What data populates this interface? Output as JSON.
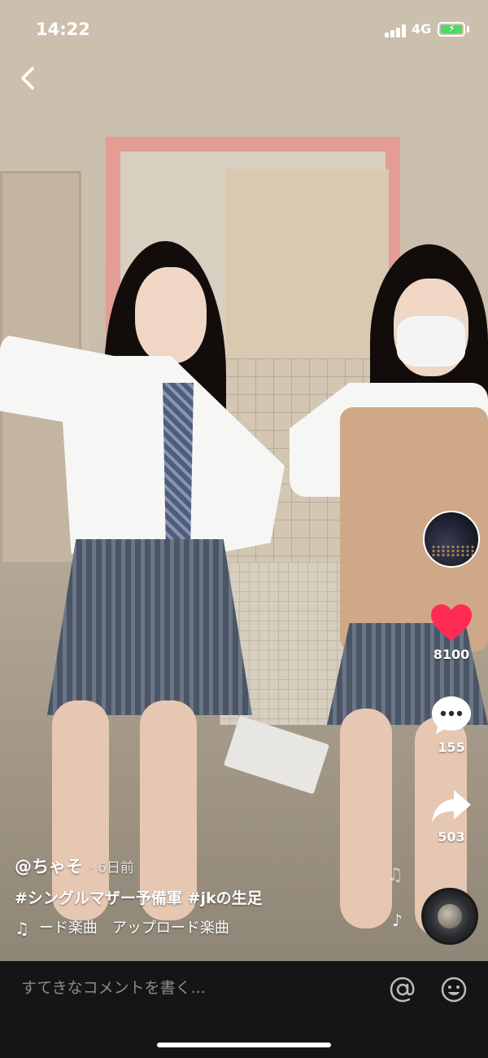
{
  "status_bar": {
    "time": "14:22",
    "network": "4G",
    "battery_charging": true,
    "battery_color": "#4cd964"
  },
  "nav": {
    "back_icon": "chevron-left-icon"
  },
  "right_rail": {
    "avatar_icon": "profile-avatar",
    "like_icon": "heart-icon",
    "like_color": "#fe2c55",
    "like_count": "8100",
    "comment_icon": "comment-bubble-icon",
    "comment_count": "155",
    "share_icon": "share-arrow-icon",
    "share_count": "503",
    "music_disc_icon": "music-disc-icon"
  },
  "caption": {
    "author": "@ちゃそ",
    "time_ago": "· 6日前",
    "hashtags": "#シングルマザー予備軍 #jkの生足",
    "music_icon": "music-note-icon",
    "music_text": "ード楽曲　アップロード楽曲"
  },
  "comment_bar": {
    "placeholder": "すてきなコメントを書く...",
    "mention_icon": "at-icon",
    "emoji_icon": "emoji-icon"
  }
}
